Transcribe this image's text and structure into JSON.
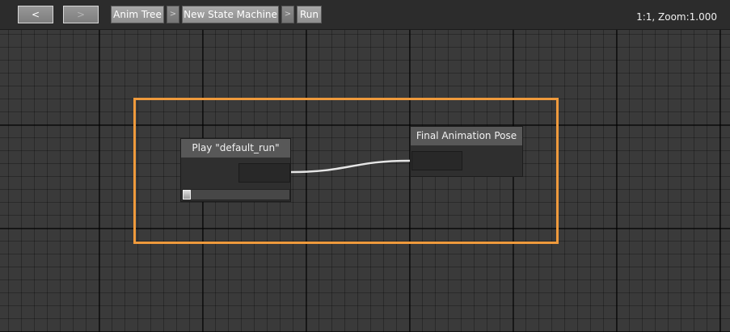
{
  "toolbar": {
    "back_label": "<",
    "forward_label": ">",
    "breadcrumbs": [
      {
        "label": "Anim Tree"
      },
      {
        "label": "New State Machine"
      },
      {
        "label": "Run"
      }
    ],
    "separator_glyph": ">",
    "zoom_readout": "1:1, Zoom:1.000"
  },
  "graph": {
    "selection_color": "#ef9a3c",
    "nodes": {
      "play": {
        "title": "Play \"default_run\"",
        "progress": 0
      },
      "final": {
        "title": "Final Animation Pose"
      }
    }
  }
}
